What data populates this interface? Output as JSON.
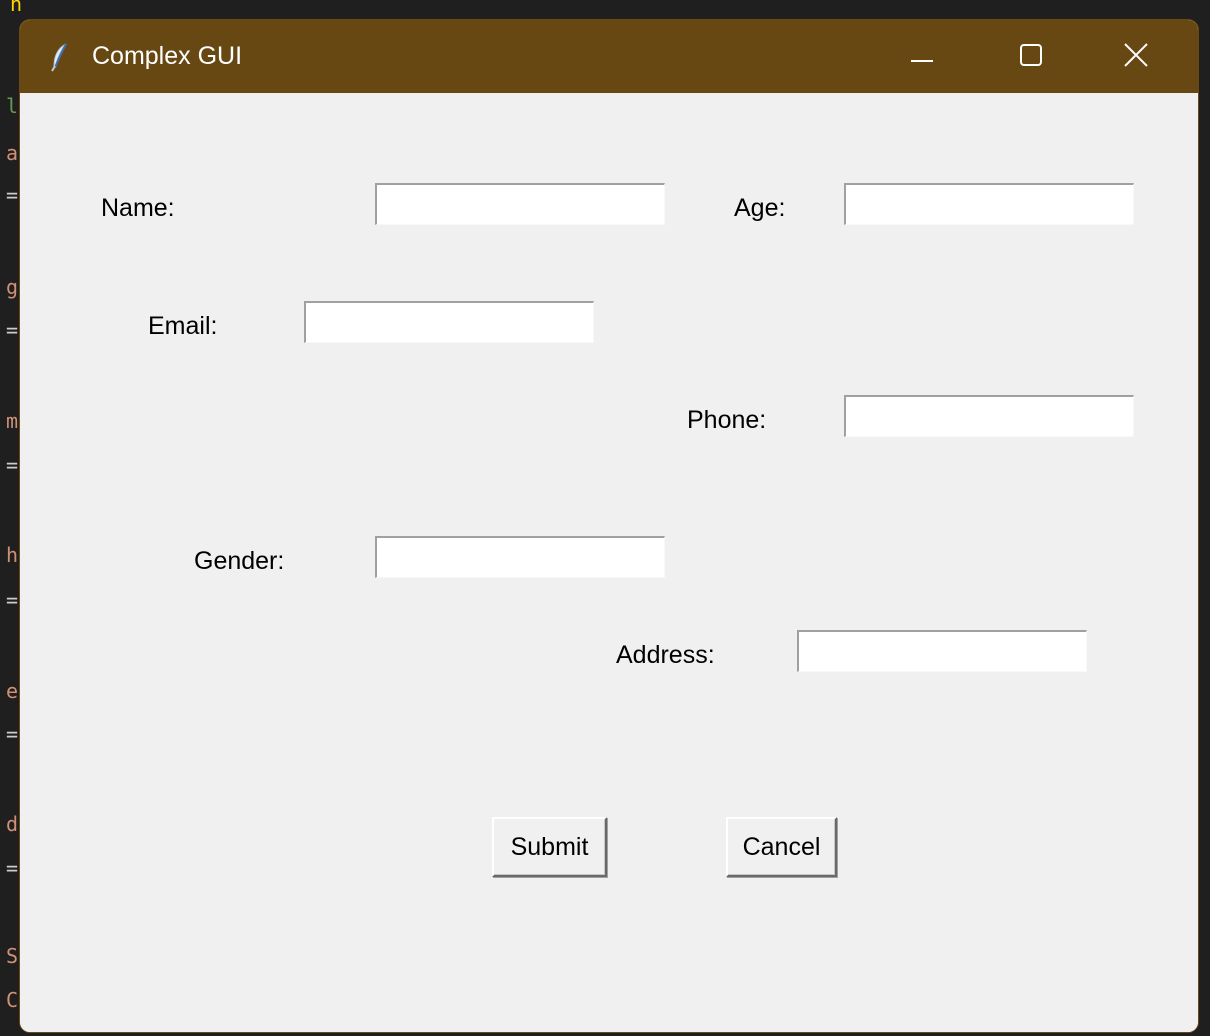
{
  "window": {
    "title": "Complex GUI",
    "titlebar_color": "#674813",
    "background_color": "#f0f0f0",
    "icons": {
      "app": "feather-icon",
      "minimize": "minimize-icon",
      "maximize": "maximize-icon",
      "close": "close-icon"
    }
  },
  "form": {
    "name": {
      "label": "Name:",
      "value": ""
    },
    "age": {
      "label": "Age:",
      "value": ""
    },
    "email": {
      "label": "Email:",
      "value": ""
    },
    "phone": {
      "label": "Phone:",
      "value": ""
    },
    "gender": {
      "label": "Gender:",
      "value": ""
    },
    "address": {
      "label": "Address:",
      "value": ""
    }
  },
  "buttons": {
    "submit": "Submit",
    "cancel": "Cancel"
  },
  "background_editor": {
    "chars": [
      "n",
      "l",
      "a",
      "=",
      "g",
      "=",
      "m",
      "=",
      "h",
      "=",
      "e",
      "=",
      "d",
      "=",
      "S",
      "C"
    ]
  }
}
